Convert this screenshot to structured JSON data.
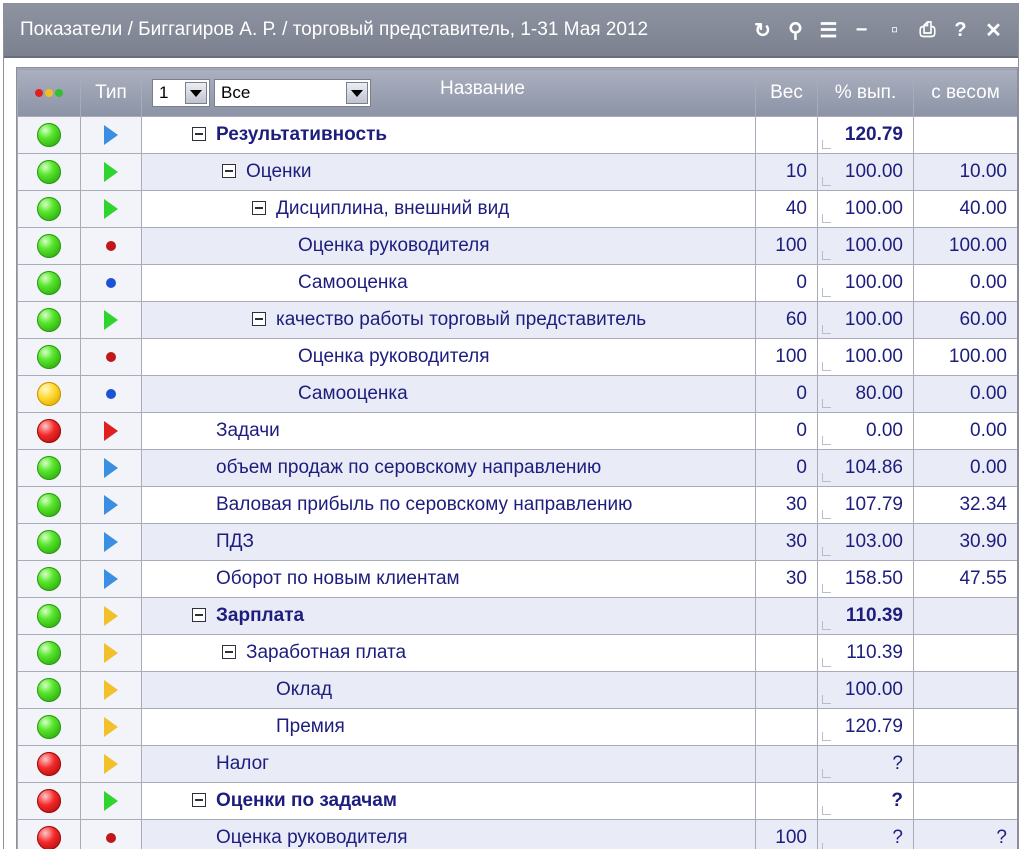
{
  "window": {
    "title": "Показатели / Биггагиров А. Р. / торговый представитель, 1-31 Мая 2012",
    "tools": [
      {
        "name": "refresh-icon",
        "glyph": "↻"
      },
      {
        "name": "search-icon",
        "glyph": "⚲"
      },
      {
        "name": "list-icon",
        "glyph": "☰"
      },
      {
        "name": "minimize-icon",
        "glyph": "−"
      },
      {
        "name": "maximize-icon",
        "glyph": "▫"
      },
      {
        "name": "print-icon",
        "glyph": "⎙"
      },
      {
        "name": "help-icon",
        "glyph": "?"
      },
      {
        "name": "close-icon",
        "glyph": "✕"
      }
    ]
  },
  "grid": {
    "headers": {
      "status": "",
      "type": "Тип",
      "name": "Название",
      "weight": "Вес",
      "percent": "% вып.",
      "weighted": "с весом"
    },
    "level_select": "1",
    "filter_select": "Все",
    "rows": [
      {
        "status": "green",
        "type": "tri-blue",
        "indent": 1,
        "toggle": true,
        "bold": true,
        "name": "Результативность",
        "weight": "",
        "percent": "120.79",
        "weighted": "",
        "shade": false
      },
      {
        "status": "green",
        "type": "tri-green",
        "indent": 2,
        "toggle": true,
        "bold": false,
        "name": "Оценки",
        "weight": "10",
        "percent": "100.00",
        "weighted": "10.00",
        "shade": true
      },
      {
        "status": "green",
        "type": "tri-green",
        "indent": 3,
        "toggle": true,
        "bold": false,
        "name": "Дисциплина, внешний вид",
        "weight": "40",
        "percent": "100.00",
        "weighted": "40.00",
        "shade": false
      },
      {
        "status": "green",
        "type": "dot-red",
        "indent": 4,
        "toggle": false,
        "bold": false,
        "name": "Оценка руководителя",
        "weight": "100",
        "percent": "100.00",
        "weighted": "100.00",
        "shade": true
      },
      {
        "status": "green",
        "type": "dot-blue",
        "indent": 4,
        "toggle": false,
        "bold": false,
        "name": "Самооценка",
        "weight": "0",
        "percent": "100.00",
        "weighted": "0.00",
        "shade": false
      },
      {
        "status": "green",
        "type": "tri-green",
        "indent": 3,
        "toggle": true,
        "bold": false,
        "name": "качество работы торговый представитель",
        "weight": "60",
        "percent": "100.00",
        "weighted": "60.00",
        "shade": true
      },
      {
        "status": "green",
        "type": "dot-red",
        "indent": 4,
        "toggle": false,
        "bold": false,
        "name": "Оценка руководителя",
        "weight": "100",
        "percent": "100.00",
        "weighted": "100.00",
        "shade": false
      },
      {
        "status": "yellow",
        "type": "dot-blue",
        "indent": 4,
        "toggle": false,
        "bold": false,
        "name": "Самооценка",
        "weight": "0",
        "percent": "80.00",
        "weighted": "0.00",
        "shade": true
      },
      {
        "status": "red",
        "type": "tri-red",
        "indent": 1,
        "toggle": false,
        "bold": false,
        "name": "Задачи",
        "weight": "0",
        "percent": "0.00",
        "weighted": "0.00",
        "shade": false
      },
      {
        "status": "green",
        "type": "tri-blue",
        "indent": 1,
        "toggle": false,
        "bold": false,
        "name": "объем продаж по серовскому направлению",
        "weight": "0",
        "percent": "104.86",
        "weighted": "0.00",
        "shade": true
      },
      {
        "status": "green",
        "type": "tri-blue",
        "indent": 1,
        "toggle": false,
        "bold": false,
        "name": "Валовая прибыль по серовскому направлению",
        "weight": "30",
        "percent": "107.79",
        "weighted": "32.34",
        "shade": false
      },
      {
        "status": "green",
        "type": "tri-blue",
        "indent": 1,
        "toggle": false,
        "bold": false,
        "name": "ПДЗ",
        "weight": "30",
        "percent": "103.00",
        "weighted": "30.90",
        "shade": true
      },
      {
        "status": "green",
        "type": "tri-blue",
        "indent": 1,
        "toggle": false,
        "bold": false,
        "name": "Оборот по новым клиентам",
        "weight": "30",
        "percent": "158.50",
        "weighted": "47.55",
        "shade": false
      },
      {
        "status": "green",
        "type": "tri-yellow",
        "indent": 1,
        "toggle": true,
        "bold": true,
        "name": "Зарплата",
        "weight": "",
        "percent": "110.39",
        "weighted": "",
        "shade": true
      },
      {
        "status": "green",
        "type": "tri-yellow",
        "indent": 2,
        "toggle": true,
        "bold": false,
        "name": "Заработная плата",
        "weight": "",
        "percent": "110.39",
        "weighted": "",
        "shade": false
      },
      {
        "status": "green",
        "type": "tri-yellow",
        "indent": 3,
        "toggle": false,
        "bold": false,
        "name": "Оклад",
        "weight": "",
        "percent": "100.00",
        "weighted": "",
        "shade": true
      },
      {
        "status": "green",
        "type": "tri-yellow",
        "indent": 3,
        "toggle": false,
        "bold": false,
        "name": "Премия",
        "weight": "",
        "percent": "120.79",
        "weighted": "",
        "shade": false
      },
      {
        "status": "red",
        "type": "tri-yellow",
        "indent": 1,
        "toggle": false,
        "bold": false,
        "name": "Налог",
        "weight": "",
        "percent": "?",
        "weighted": "",
        "shade": true
      },
      {
        "status": "red",
        "type": "tri-green",
        "indent": 1,
        "toggle": true,
        "bold": true,
        "name": "Оценки по задачам",
        "weight": "",
        "percent": "?",
        "weighted": "",
        "shade": false
      },
      {
        "status": "red",
        "type": "dot-red",
        "indent": 1,
        "toggle": false,
        "bold": false,
        "name": "Оценка руководителя",
        "weight": "100",
        "percent": "?",
        "weighted": "?",
        "shade": true
      }
    ]
  },
  "colors": {
    "status_green": "#3fcc1c",
    "status_yellow": "#ffd930",
    "status_red": "#e01c1c",
    "title_bar": "#858a99",
    "text": "#1d1d7e"
  }
}
